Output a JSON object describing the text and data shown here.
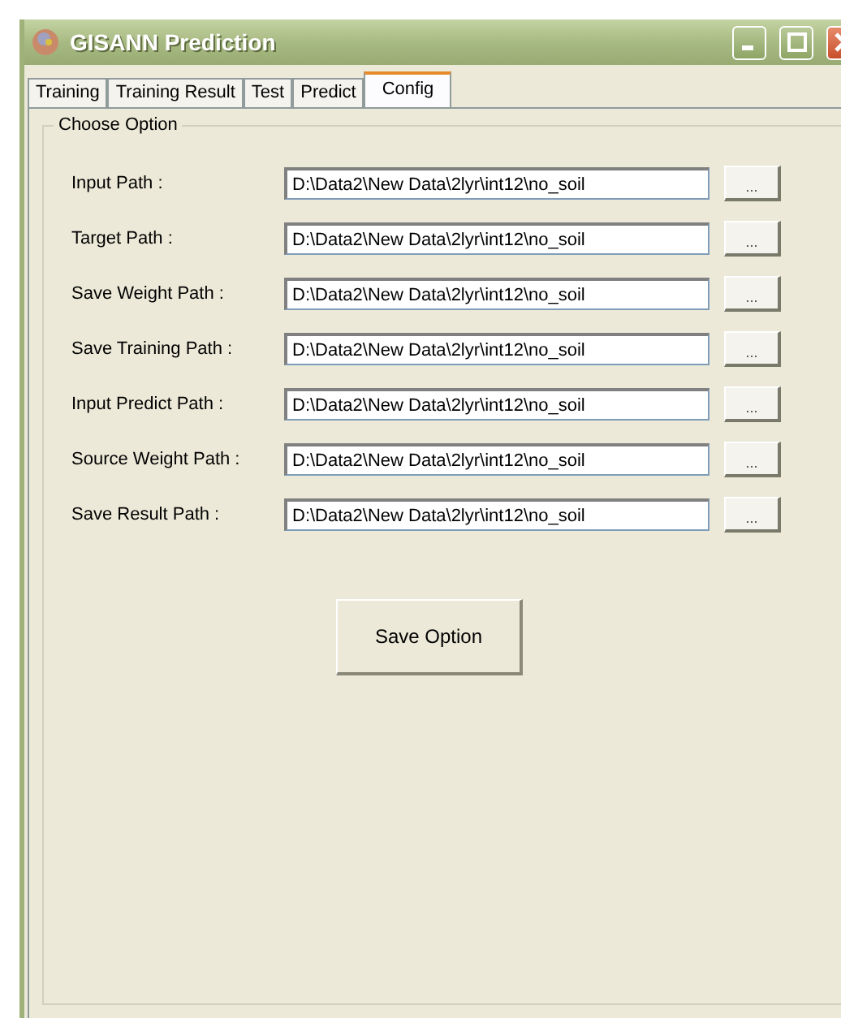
{
  "window": {
    "title": "GISANN Prediction"
  },
  "tabs": [
    {
      "label": "Training",
      "selected": false
    },
    {
      "label": "Training Result",
      "selected": false
    },
    {
      "label": "Test",
      "selected": false
    },
    {
      "label": "Predict",
      "selected": false
    },
    {
      "label": "Config",
      "selected": true
    }
  ],
  "group": {
    "title": "Choose Option"
  },
  "paths": [
    {
      "label": "Input Path :",
      "value": "D:\\Data2\\New Data\\2lyr\\int12\\no_soil",
      "button": "..."
    },
    {
      "label": "Target Path :",
      "value": "D:\\Data2\\New Data\\2lyr\\int12\\no_soil",
      "button": "..."
    },
    {
      "label": "Save Weight Path :",
      "value": "D:\\Data2\\New Data\\2lyr\\int12\\no_soil",
      "button": "..."
    },
    {
      "label": "Save Training Path :",
      "value": "D:\\Data2\\New Data\\2lyr\\int12\\no_soil",
      "button": "..."
    },
    {
      "label": "Input Predict Path :",
      "value": "D:\\Data2\\New Data\\2lyr\\int12\\no_soil",
      "button": "..."
    },
    {
      "label": "Source Weight Path :",
      "value": "D:\\Data2\\New Data\\2lyr\\int12\\no_soil",
      "button": "..."
    },
    {
      "label": "Save Result Path :",
      "value": "D:\\Data2\\New Data\\2lyr\\int12\\no_soil",
      "button": "..."
    }
  ],
  "save_button": "Save Option"
}
